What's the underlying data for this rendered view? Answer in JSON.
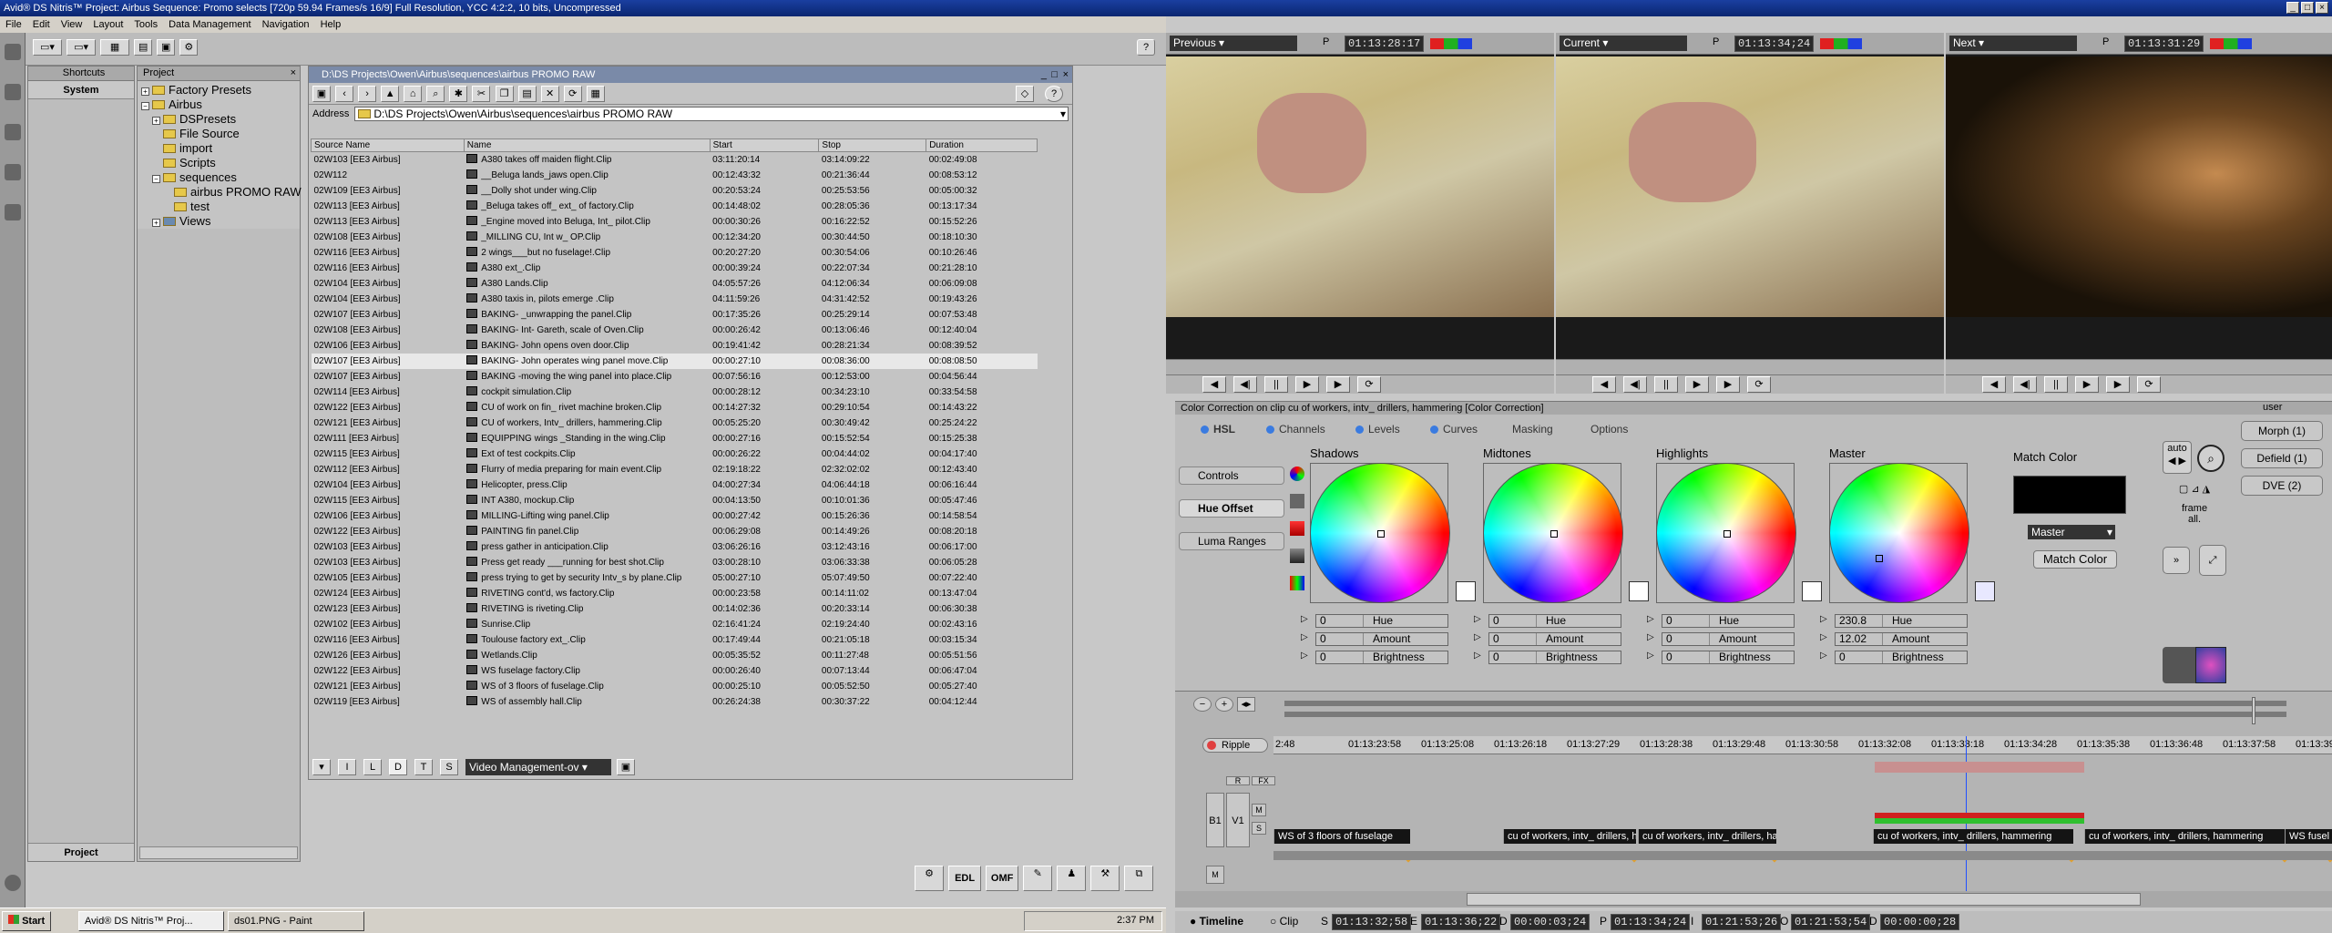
{
  "window": {
    "title": "Avid® DS Nitris™ Project: Airbus    Sequence: Promo selects    [720p 59.94 Frames/s 16/9]    Full Resolution, YCC 4:2:2, 10 bits, Uncompressed"
  },
  "menu": [
    "File",
    "Edit",
    "View",
    "Layout",
    "Tools",
    "Data Management",
    "Navigation",
    "Help"
  ],
  "shortcuts": {
    "title": "Shortcuts",
    "system": "System",
    "project": "Project"
  },
  "project": {
    "title": "Project",
    "tree": [
      "Factory Presets",
      "Airbus",
      "DSPresets",
      "File Source",
      "import",
      "Scripts",
      "sequences",
      "airbus PROMO RAW",
      "test",
      "Views"
    ]
  },
  "browser": {
    "title": "D:\\DS Projects\\Owen\\Airbus\\sequences\\airbus PROMO RAW",
    "address_label": "Address",
    "address": "D:\\DS Projects\\Owen\\Airbus\\sequences\\airbus PROMO RAW",
    "columns": [
      "Source Name",
      "Name",
      "Start",
      "Stop",
      "Duration"
    ],
    "rows": [
      [
        "02W103 [EE3 Airbus]",
        "A380 takes off maiden flight.Clip",
        "03:11:20:14",
        "03:14:09:22",
        "00:02:49:08"
      ],
      [
        "02W112",
        "__Beluga lands_jaws open.Clip",
        "00:12:43:32",
        "00:21:36:44",
        "00:08:53:12"
      ],
      [
        "02W109 [EE3 Airbus]",
        "__Dolly shot under wing.Clip",
        "00:20:53:24",
        "00:25:53:56",
        "00:05:00:32"
      ],
      [
        "02W113 [EE3 Airbus]",
        "_Beluga takes off_ ext_ of factory.Clip",
        "00:14:48:02",
        "00:28:05:36",
        "00:13:17:34"
      ],
      [
        "02W113 [EE3 Airbus]",
        "_Engine moved into Beluga, Int_ pilot.Clip",
        "00:00:30:26",
        "00:16:22:52",
        "00:15:52:26"
      ],
      [
        "02W108 [EE3 Airbus]",
        "_MILLING CU, Int w_ OP.Clip",
        "00:12:34:20",
        "00:30:44:50",
        "00:18:10:30"
      ],
      [
        "02W116 [EE3 Airbus]",
        "2 wings___but no fuselage!.Clip",
        "00:20:27:20",
        "00:30:54:06",
        "00:10:26:46"
      ],
      [
        "02W116 [EE3 Airbus]",
        "A380 ext_.Clip",
        "00:00:39:24",
        "00:22:07:34",
        "00:21:28:10"
      ],
      [
        "02W104 [EE3 Airbus]",
        "A380 Lands.Clip",
        "04:05:57:26",
        "04:12:06:34",
        "00:06:09:08"
      ],
      [
        "02W104 [EE3 Airbus]",
        "A380 taxis in, pilots emerge  .Clip",
        "04:11:59:26",
        "04:31:42:52",
        "00:19:43:26"
      ],
      [
        "02W107 [EE3 Airbus]",
        "BAKING- _unwrapping the panel.Clip",
        "00:17:35:26",
        "00:25:29:14",
        "00:07:53:48"
      ],
      [
        "02W108 [EE3 Airbus]",
        "BAKING- Int- Gareth, scale of Oven.Clip",
        "00:00:26:42",
        "00:13:06:46",
        "00:12:40:04"
      ],
      [
        "02W106 [EE3 Airbus]",
        "BAKING- John opens oven door.Clip",
        "00:19:41:42",
        "00:28:21:34",
        "00:08:39:52"
      ],
      [
        "02W107 [EE3 Airbus]",
        "BAKING- John operates wing panel move.Clip",
        "00:00:27:10",
        "00:08:36:00",
        "00:08:08:50"
      ],
      [
        "02W107 [EE3 Airbus]",
        "BAKING -moving the wing panel into place.Clip",
        "00:07:56:16",
        "00:12:53:00",
        "00:04:56:44"
      ],
      [
        "02W114 [EE3 Airbus]",
        "cockpit simulation.Clip",
        "00:00:28:12",
        "00:34:23:10",
        "00:33:54:58"
      ],
      [
        "02W122 [EE3 Airbus]",
        "CU of work on fin_ rivet machine broken.Clip",
        "00:14:27:32",
        "00:29:10:54",
        "00:14:43:22"
      ],
      [
        "02W121 [EE3 Airbus]",
        "CU of workers, Intv_ drillers, hammering.Clip",
        "00:05:25:20",
        "00:30:49:42",
        "00:25:24:22"
      ],
      [
        "02W111 [EE3 Airbus]",
        "EQUIPPING wings _Standing in the wing.Clip",
        "00:00:27:16",
        "00:15:52:54",
        "00:15:25:38"
      ],
      [
        "02W115 [EE3 Airbus]",
        "Ext of test cockpits.Clip",
        "00:00:26:22",
        "00:04:44:02",
        "00:04:17:40"
      ],
      [
        "02W112 [EE3 Airbus]",
        "Flurry of media preparing for main event.Clip",
        "02:19:18:22",
        "02:32:02:02",
        "00:12:43:40"
      ],
      [
        "02W104 [EE3 Airbus]",
        "Helicopter, press.Clip",
        "04:00:27:34",
        "04:06:44:18",
        "00:06:16:44"
      ],
      [
        "02W115 [EE3 Airbus]",
        "INT A380, mockup.Clip",
        "00:04:13:50",
        "00:10:01:36",
        "00:05:47:46"
      ],
      [
        "02W106 [EE3 Airbus]",
        "MILLING-Lifting wing panel.Clip",
        "00:00:27:42",
        "00:15:26:36",
        "00:14:58:54"
      ],
      [
        "02W122 [EE3 Airbus]",
        "PAINTING fin panel.Clip",
        "00:06:29:08",
        "00:14:49:26",
        "00:08:20:18"
      ],
      [
        "02W103 [EE3 Airbus]",
        "press gather in anticipation.Clip",
        "03:06:26:16",
        "03:12:43:16",
        "00:06:17:00"
      ],
      [
        "02W103 [EE3 Airbus]",
        "Press get ready ___running for best shot.Clip",
        "03:00:28:10",
        "03:06:33:38",
        "00:06:05:28"
      ],
      [
        "02W105 [EE3 Airbus]",
        "press trying to get by security  Intv_s by plane.Clip",
        "05:00:27:10",
        "05:07:49:50",
        "00:07:22:40"
      ],
      [
        "02W124 [EE3 Airbus]",
        "RIVETING cont'd, ws factory.Clip",
        "00:00:23:58",
        "00:14:11:02",
        "00:13:47:04"
      ],
      [
        "02W123 [EE3 Airbus]",
        "RIVETING is riveting.Clip",
        "00:14:02:36",
        "00:20:33:14",
        "00:06:30:38"
      ],
      [
        "02W102 [EE3 Airbus]",
        "Sunrise.Clip",
        "02:16:41:24",
        "02:19:24:40",
        "00:02:43:16"
      ],
      [
        "02W116 [EE3 Airbus]",
        "Toulouse factory ext_.Clip",
        "00:17:49:44",
        "00:21:05:18",
        "00:03:15:34"
      ],
      [
        "02W126 [EE3 Airbus]",
        "Wetlands.Clip",
        "00:05:35:52",
        "00:11:27:48",
        "00:05:51:56"
      ],
      [
        "02W122 [EE3 Airbus]",
        "WS fuselage factory.Clip",
        "00:00:26:40",
        "00:07:13:44",
        "00:06:47:04"
      ],
      [
        "02W121 [EE3 Airbus]",
        "WS of 3 floors of fuselage.Clip",
        "00:00:25:10",
        "00:05:52:50",
        "00:05:27:40"
      ],
      [
        "02W119 [EE3 Airbus]",
        "WS of assembly hall.Clip",
        "00:26:24:38",
        "00:30:37:22",
        "00:04:12:44"
      ]
    ],
    "selected_row": 13,
    "footer_buttons": [
      "I",
      "L",
      "D",
      "T",
      "S"
    ],
    "view_select": "Video Management-ov"
  },
  "bottom_tools": [
    "EDL",
    "OMF"
  ],
  "viewers": [
    {
      "label": "Previous",
      "tc": "01:13:28:17"
    },
    {
      "label": "Current",
      "tc": "01:13:34;24"
    },
    {
      "label": "Next",
      "tc": "01:13:31:29"
    }
  ],
  "color_correction": {
    "title": "Color Correction on clip cu of workers, intv_ drillers, hammering [Color Correction]",
    "user_label": "user",
    "tabs": [
      "HSL",
      "Channels",
      "Levels",
      "Curves",
      "Masking",
      "Options"
    ],
    "side_buttons": [
      "Controls",
      "Hue Offset",
      "Luma Ranges"
    ],
    "wheels": [
      {
        "name": "Shadows",
        "hue": "0",
        "amount": "0",
        "brightness": "0"
      },
      {
        "name": "Midtones",
        "hue": "0",
        "amount": "0",
        "brightness": "0"
      },
      {
        "name": "Highlights",
        "hue": "0",
        "amount": "0",
        "brightness": "0"
      },
      {
        "name": "Master",
        "hue": "230.8",
        "amount": "12.02",
        "brightness": "0"
      }
    ],
    "field_labels": {
      "hue": "Hue",
      "amount": "Amount",
      "brightness": "Brightness"
    },
    "match_color": {
      "label": "Match Color",
      "select": "Master",
      "button": "Match Color"
    },
    "right_buttons": [
      "Morph (1)",
      "Defield (1)",
      "DVE (2)"
    ],
    "auto_label": "auto",
    "frame_label": "frame",
    "all_label": "all."
  },
  "timeline": {
    "ripple": "Ripple",
    "ruler": [
      "2:48",
      "01:13:23:58",
      "01:13:25:08",
      "01:13:26:18",
      "01:13:27:29",
      "01:13:28:38",
      "01:13:29:48",
      "01:13:30:58",
      "01:13:32:08",
      "01:13:33:18",
      "01:13:34:28",
      "01:13:35:38",
      "01:13:36:48",
      "01:13:37:58",
      "01:13:39:08"
    ],
    "clips": [
      "WS of 3 floors of fuselage",
      "cu of workers, intv_ drillers, ha",
      "cu of workers, intv_ drillers, hammering",
      "cu of workers, intv_ drillers, hammering",
      "cu of workers, intv_ drillers, hammering",
      "WS fusel"
    ],
    "track_labels": [
      "B1",
      "V1",
      "R",
      "FX",
      "M",
      "S",
      "M"
    ],
    "status": {
      "timeline": "Timeline",
      "clip": "Clip",
      "s": "01:13:32;58",
      "e": "01:13:36;22",
      "d": "00:00:03;24",
      "p": "01:13:34;24",
      "i": "01:21:53;26",
      "o": "01:21:53;54",
      "d2": "00:00:00;28"
    }
  },
  "taskbar": {
    "start": "Start",
    "tasks": [
      "Avid® DS Nitris™ Proj...",
      "ds01.PNG - Paint"
    ],
    "clock": "2:37 PM"
  }
}
